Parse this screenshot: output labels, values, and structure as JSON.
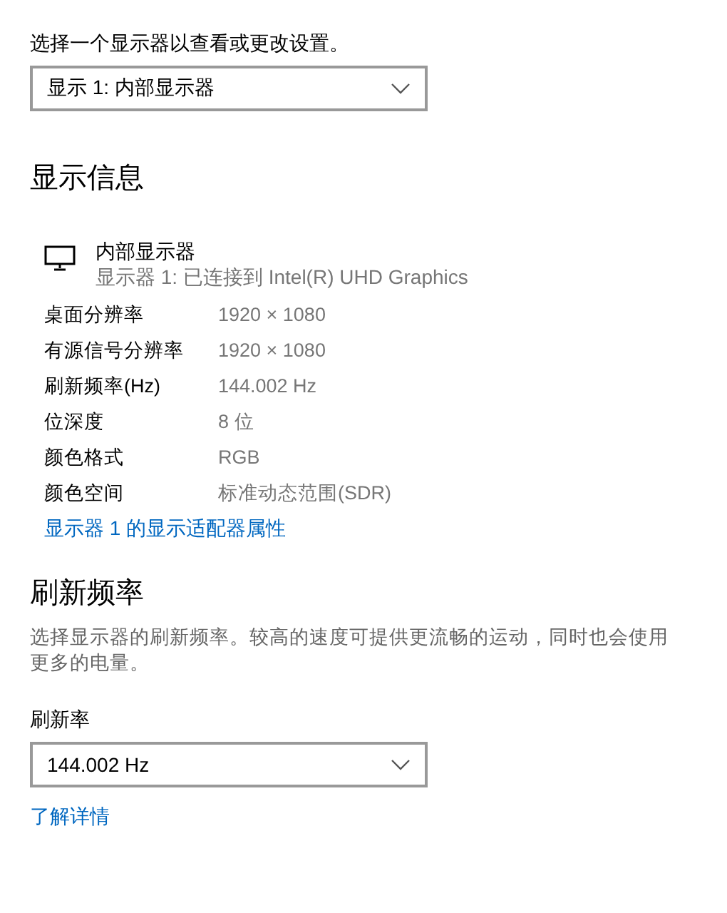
{
  "display_select": {
    "label": "选择一个显示器以查看或更改设置。",
    "value": "显示 1: 内部显示器"
  },
  "display_info": {
    "heading": "显示信息",
    "monitor": {
      "name": "内部显示器",
      "connection": "显示器 1: 已连接到 Intel(R) UHD Graphics"
    },
    "rows": [
      {
        "label": "桌面分辨率",
        "value": "1920 × 1080"
      },
      {
        "label": "有源信号分辨率",
        "value": "1920 × 1080"
      },
      {
        "label": "刷新频率(Hz)",
        "value": "144.002 Hz"
      },
      {
        "label": "位深度",
        "value": "8 位"
      },
      {
        "label": "颜色格式",
        "value": "RGB"
      },
      {
        "label": "颜色空间",
        "value": "标准动态范围(SDR)"
      }
    ],
    "link": "显示器 1 的显示适配器属性"
  },
  "refresh": {
    "heading": "刷新频率",
    "description": "选择显示器的刷新频率。较高的速度可提供更流畅的运动，同时也会使用更多的电量。",
    "label": "刷新率",
    "value": "144.002 Hz",
    "link": "了解详情"
  }
}
